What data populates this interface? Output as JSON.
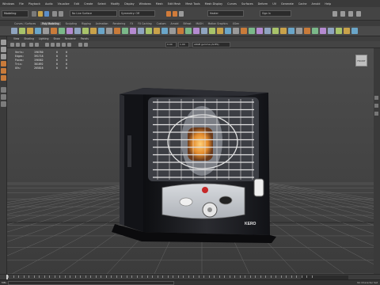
{
  "menubar": [
    "Windows",
    "File",
    "Playback",
    "Audio",
    "Visualize",
    "Edit",
    "Create",
    "Select",
    "Modify",
    "Display",
    "Windows",
    "Mesh",
    "Edit Mesh",
    "Mesh Tools",
    "Mesh Display",
    "Curves",
    "Surfaces",
    "Deform",
    "UV",
    "Generate",
    "Cache",
    "Arnold",
    "Help"
  ],
  "status": {
    "mode": "Modeling",
    "workspace_label": "No Live Surface",
    "symmetry_label": "Symmetry: Off",
    "search_value": "Heater",
    "sign_in": "Sign In"
  },
  "shelf_tabs": [
    "Curves / Surfaces",
    "Poly Modeling",
    "Sculpting",
    "Rigging",
    "Animation",
    "Rendering",
    "FX",
    "FX Caching",
    "Custom",
    "Arnold",
    "Bifrost",
    "MASH",
    "Motion Graphics",
    "XGen"
  ],
  "shelf_tab_active": 1,
  "panel_menu": [
    "View",
    "Shading",
    "Lighting",
    "Show",
    "Renderer",
    "Panels"
  ],
  "panel_field_values": {
    "exposure": "0.00",
    "gamma": "1.00",
    "colorspace": "sRGB gamma (ACES)"
  },
  "hud": {
    "rows": [
      {
        "label": "Verts:",
        "v1": "196780",
        "v2": "0",
        "v3": "0"
      },
      {
        "label": "Edges:",
        "v1": "391718",
        "v2": "0",
        "v3": "0"
      },
      {
        "label": "Faces:",
        "v1": "196582",
        "v2": "0",
        "v3": "0"
      },
      {
        "label": "Tris:",
        "v1": "381892",
        "v2": "0",
        "v3": "0"
      },
      {
        "label": "UVs:",
        "v1": "205816",
        "v2": "0",
        "v3": "0"
      }
    ]
  },
  "viewcube_label": "FRONT",
  "model": {
    "brand_text": "KERO",
    "body_color": "#1c1d21",
    "grill_color": "#d9d9d9",
    "flame_color": "#e38a2b",
    "panel_color": "#c9ccd2"
  },
  "command": {
    "label": "MEL",
    "status": "No Character Set"
  },
  "timeline": {
    "end_label": "120"
  }
}
